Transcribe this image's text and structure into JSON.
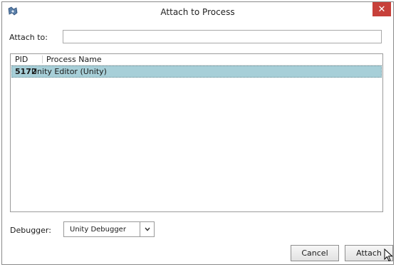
{
  "window": {
    "title": "Attach to Process",
    "close_label": "✕"
  },
  "filter": {
    "label": "Attach to:",
    "value": "",
    "placeholder": ""
  },
  "process_list": {
    "columns": [
      "PID",
      "Process Name"
    ],
    "rows": [
      {
        "pid": "5172",
        "name": "Unity Editor (Unity)",
        "selected": true
      }
    ]
  },
  "debugger": {
    "label": "Debugger:",
    "selected": "Unity Debugger"
  },
  "buttons": {
    "cancel": "Cancel",
    "attach": "Attach"
  },
  "colors": {
    "selection": "#a7cfd8",
    "close_button": "#c7403a"
  },
  "icons": {
    "app": "app-icon",
    "close": "close-icon",
    "dropdown": "chevron-down-icon",
    "cursor": "mouse-pointer-icon"
  }
}
